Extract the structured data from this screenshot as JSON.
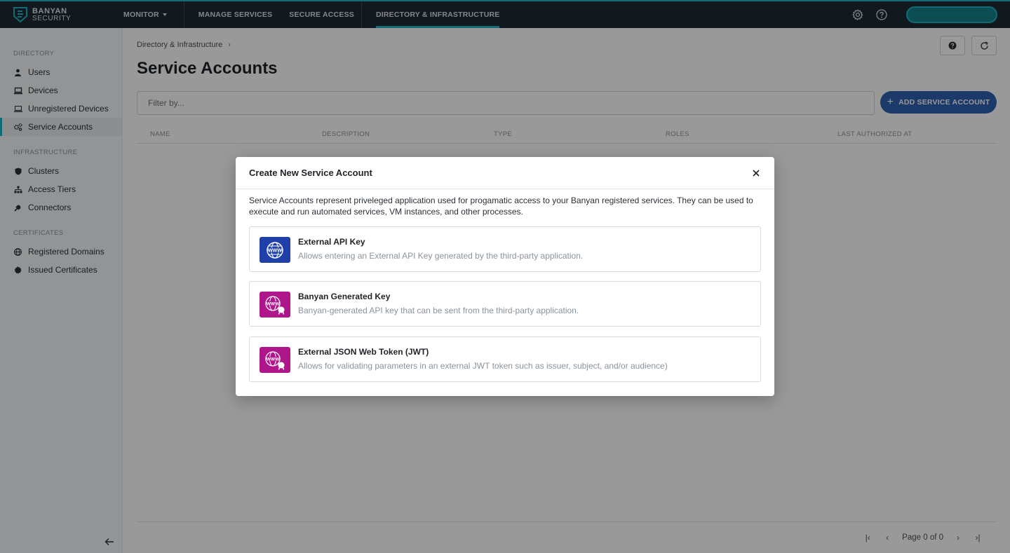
{
  "brand": {
    "line1": "BANYAN",
    "line2": "SECURITY"
  },
  "topnav": {
    "monitor": "MONITOR",
    "manage_services": "MANAGE SERVICES",
    "secure_access": "SECURE ACCESS",
    "directory_infrastructure": "DIRECTORY & INFRASTRUCTURE"
  },
  "sidebar": {
    "directory_label": "DIRECTORY",
    "directory_items": [
      {
        "label": "Users",
        "icon": "user-icon"
      },
      {
        "label": "Devices",
        "icon": "laptop-icon"
      },
      {
        "label": "Unregistered Devices",
        "icon": "laptop-outline-icon"
      },
      {
        "label": "Service Accounts",
        "icon": "gears-icon",
        "active": true
      }
    ],
    "infrastructure_label": "INFRASTRUCTURE",
    "infrastructure_items": [
      {
        "label": "Clusters",
        "icon": "shield-icon"
      },
      {
        "label": "Access Tiers",
        "icon": "hierarchy-icon"
      },
      {
        "label": "Connectors",
        "icon": "plug-icon"
      }
    ],
    "certificates_label": "CERTIFICATES",
    "certificates_items": [
      {
        "label": "Registered Domains",
        "icon": "globe-icon"
      },
      {
        "label": "Issued Certificates",
        "icon": "badge-icon"
      }
    ]
  },
  "main": {
    "breadcrumb": "Directory & Infrastructure",
    "title": "Service Accounts",
    "filter_placeholder": "Filter by...",
    "add_button": "ADD SERVICE ACCOUNT",
    "columns": [
      "NAME",
      "DESCRIPTION",
      "TYPE",
      "ROLES",
      "LAST AUTHORIZED AT"
    ],
    "pager_text": "Page 0 of 0"
  },
  "modal": {
    "title": "Create New Service Account",
    "description": "Service Accounts represent priveleged application used for progamatic access to your Banyan registered services. They can be used to execute and run automated services, VM instances, and other processes.",
    "options": [
      {
        "title": "External API Key",
        "desc": "Allows entering an External API Key generated by the third-party application.",
        "color": "#1e40a8",
        "icon": "www-globe-icon"
      },
      {
        "title": "Banyan Generated Key",
        "desc": "Banyan-generated API key that can be sent from the third-party application.",
        "color": "#b0168c",
        "icon": "www-certificate-icon"
      },
      {
        "title": "External JSON Web Token (JWT)",
        "desc": "Allows for validating parameters in an external JWT token such as issuer, subject, and/or audience)",
        "color": "#b0168c",
        "icon": "www-certificate-icon"
      }
    ]
  },
  "colors": {
    "accent": "#1bb3c7",
    "primary_button": "#2e5fb0",
    "topbar": "#1f2a33"
  }
}
